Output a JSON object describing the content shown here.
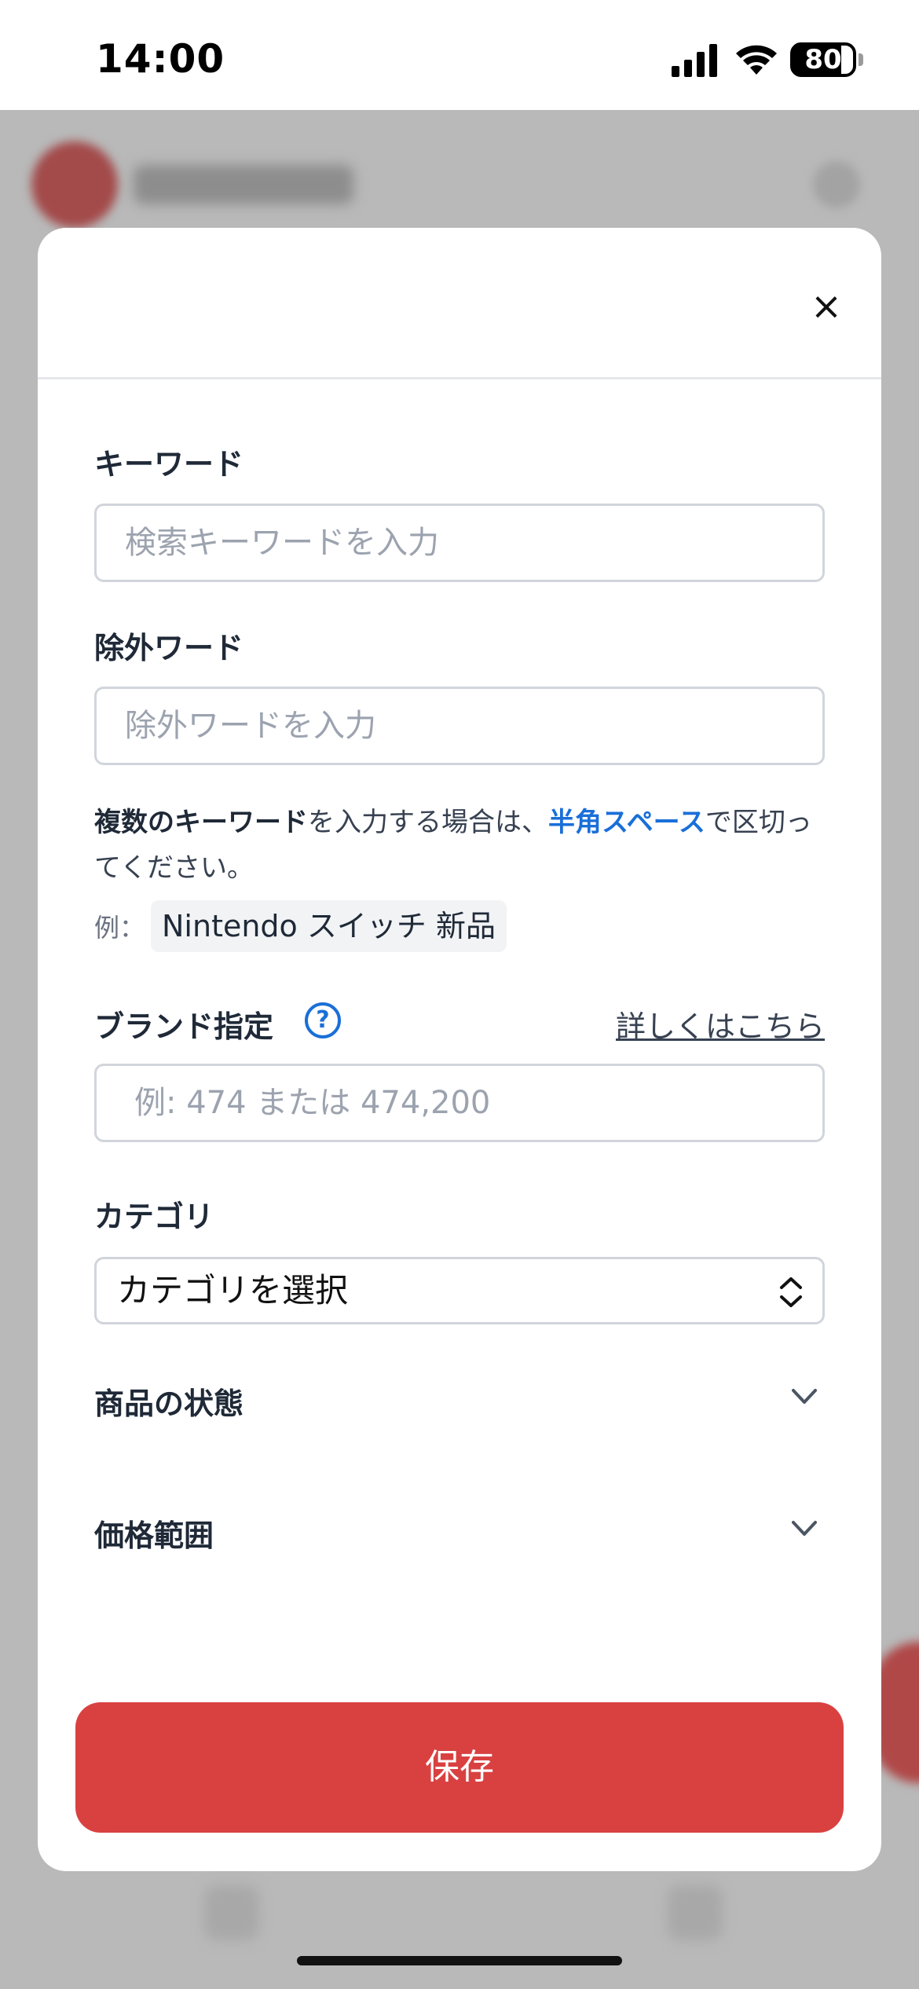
{
  "status_bar": {
    "time": "14:00",
    "battery": "80",
    "icons": [
      "signal-icon",
      "wifi-icon",
      "battery-icon"
    ]
  },
  "modal": {
    "close_label": "×",
    "keyword": {
      "label": "キーワード",
      "placeholder": "検索キーワードを入力",
      "value": ""
    },
    "exclude": {
      "label": "除外ワード",
      "placeholder": "除外ワードを入力",
      "value": ""
    },
    "help": {
      "part1": "複数のキーワード",
      "part2": "を入力する場合は、",
      "part3": "半角スペース",
      "part4": "で区切ってください。",
      "example_prefix": "例：",
      "example_value": "Nintendo スイッチ 新品"
    },
    "brand": {
      "label": "ブランド指定",
      "help_icon": "?",
      "link": "詳しくはこちら",
      "placeholder": "例: 474 または 474,200",
      "value": ""
    },
    "category": {
      "label": "カテゴリ",
      "selected": "カテゴリを選択"
    },
    "condition": {
      "label": "商品の状態"
    },
    "price": {
      "label": "価格範囲"
    },
    "save_label": "保存"
  },
  "colors": {
    "accent_red": "#d94141",
    "link_blue": "#1a6fd8",
    "border_gray": "#d1d5db",
    "overlay_gray": "#b9b9b9"
  }
}
